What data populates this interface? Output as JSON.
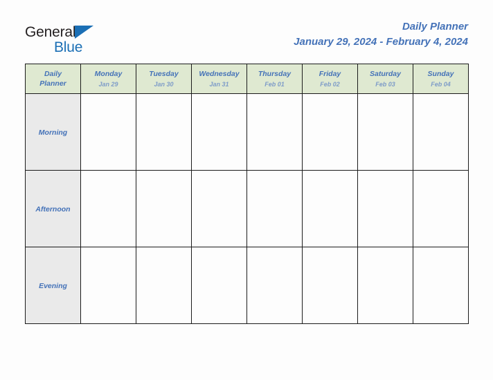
{
  "brand": {
    "word_one": "General",
    "word_two": "Blue",
    "triangle_icon": "triangle-icon"
  },
  "header": {
    "title": "Daily Planner",
    "date_range": "January 29, 2024 - February 4, 2024"
  },
  "table": {
    "corner": {
      "line_one": "Daily",
      "line_two": "Planner"
    },
    "columns": [
      {
        "day": "Monday",
        "date": "Jan 29"
      },
      {
        "day": "Tuesday",
        "date": "Jan 30"
      },
      {
        "day": "Wednesday",
        "date": "Jan 31"
      },
      {
        "day": "Thursday",
        "date": "Feb 01"
      },
      {
        "day": "Friday",
        "date": "Feb 02"
      },
      {
        "day": "Saturday",
        "date": "Feb 03"
      },
      {
        "day": "Sunday",
        "date": "Feb 04"
      }
    ],
    "rows": [
      {
        "label": "Morning",
        "cells": [
          "",
          "",
          "",
          "",
          "",
          "",
          ""
        ]
      },
      {
        "label": "Afternoon",
        "cells": [
          "",
          "",
          "",
          "",
          "",
          "",
          ""
        ]
      },
      {
        "label": "Evening",
        "cells": [
          "",
          "",
          "",
          "",
          "",
          "",
          ""
        ]
      }
    ]
  },
  "colors": {
    "accent_blue": "#4472b8",
    "logo_blue": "#1b6fb5",
    "header_green": "#dfe9d1",
    "row_label_gray": "#eaeaea",
    "grid_line": "#1a1a1a",
    "date_blue": "#7e9cc8"
  }
}
